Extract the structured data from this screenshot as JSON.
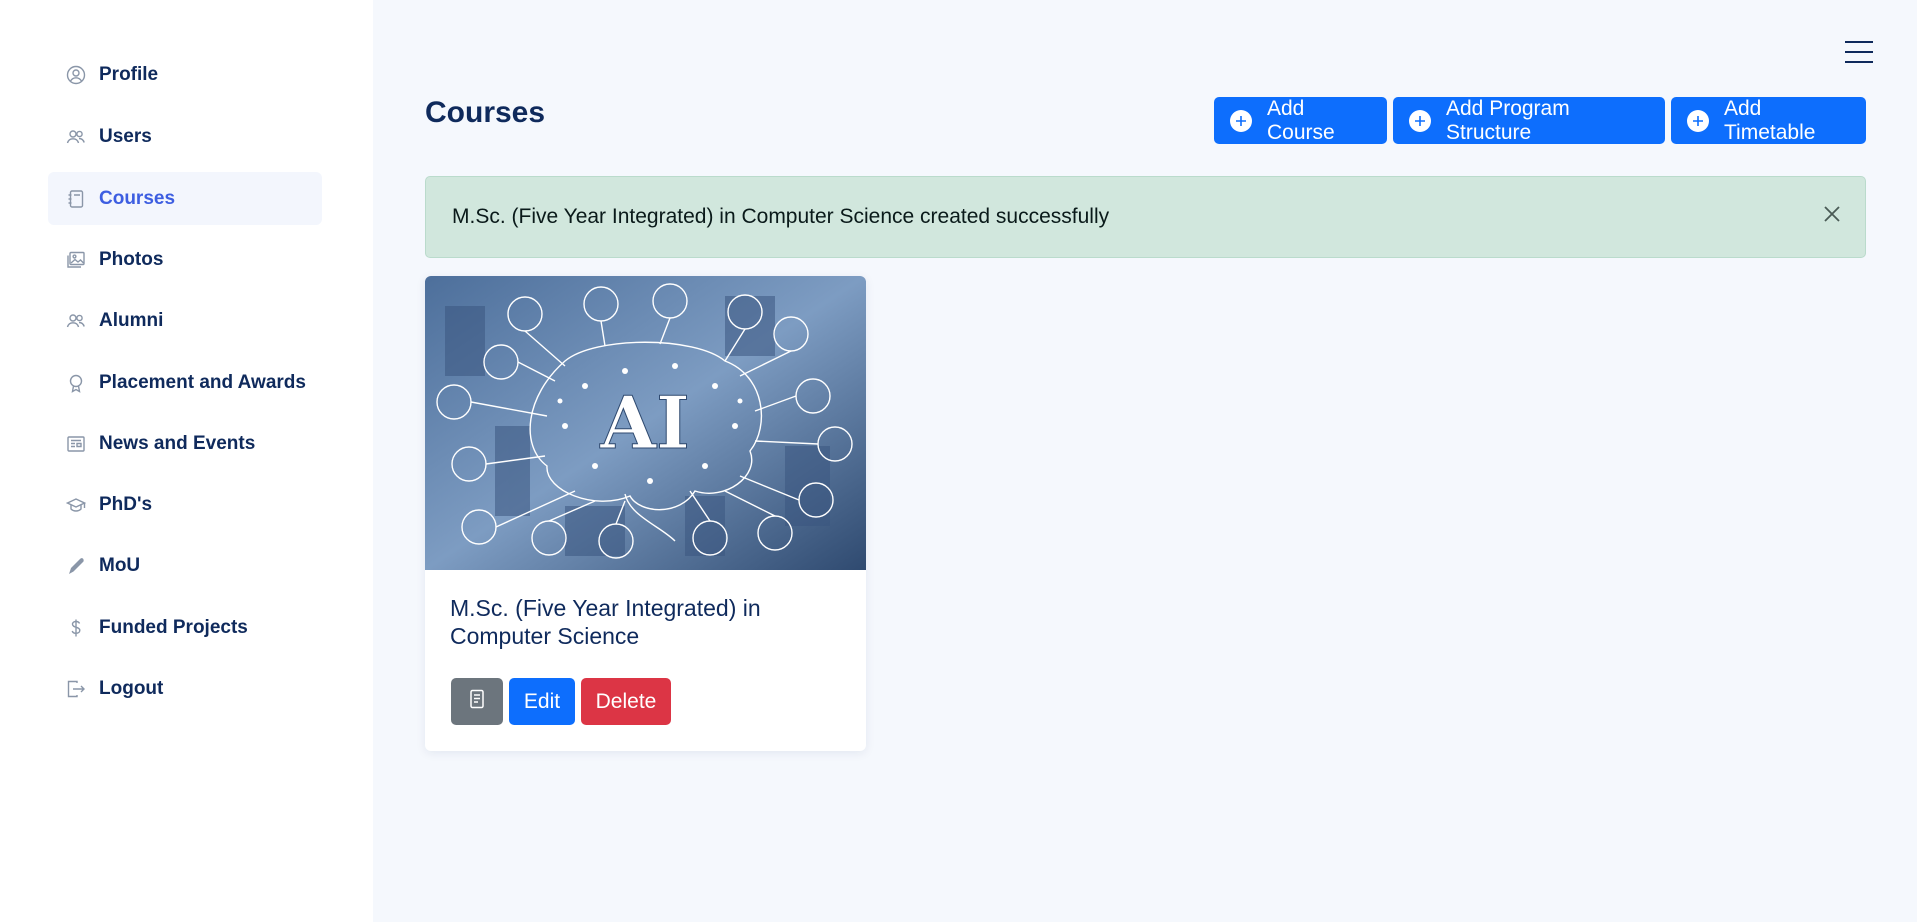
{
  "sidebar": {
    "items": [
      {
        "label": "Profile",
        "icon": "user-circle-icon",
        "active": false
      },
      {
        "label": "Users",
        "icon": "users-icon",
        "active": false
      },
      {
        "label": "Courses",
        "icon": "notebook-icon",
        "active": true
      },
      {
        "label": "Photos",
        "icon": "photos-icon",
        "active": false
      },
      {
        "label": "Alumni",
        "icon": "alumni-icon",
        "active": false
      },
      {
        "label": "Placement and Awards",
        "icon": "award-icon",
        "active": false
      },
      {
        "label": "News and Events",
        "icon": "newspaper-icon",
        "active": false
      },
      {
        "label": "PhD's",
        "icon": "graduation-cap-icon",
        "active": false
      },
      {
        "label": "MoU",
        "icon": "pen-icon",
        "active": false
      },
      {
        "label": "Funded Projects",
        "icon": "dollar-icon",
        "active": false
      },
      {
        "label": "Logout",
        "icon": "logout-icon",
        "active": false
      }
    ]
  },
  "header": {
    "title": "Courses",
    "menu_icon": "hamburger-menu-icon",
    "buttons": [
      {
        "label": "Add Course",
        "icon": "plus-circle-icon"
      },
      {
        "label": "Add Program Structure",
        "icon": "plus-circle-icon"
      },
      {
        "label": "Add Timetable",
        "icon": "plus-circle-icon"
      }
    ]
  },
  "alert": {
    "message": "M.Sc. (Five Year Integrated) in Computer Science created successfully",
    "close_icon": "close-icon"
  },
  "course_card": {
    "image_text": "AI",
    "title": "M.Sc. (Five Year Integrated) in Computer Science",
    "buttons": {
      "view_icon": "document-icon",
      "edit_label": "Edit",
      "delete_label": "Delete"
    }
  },
  "colors": {
    "primary": "#0d6efd",
    "danger": "#dc3545",
    "secondary": "#6c757d",
    "nav_text": "#0f2a5c",
    "nav_active": "#3d5ee1",
    "alert_bg": "#d1e7dd",
    "page_bg": "#f5f8fd"
  }
}
